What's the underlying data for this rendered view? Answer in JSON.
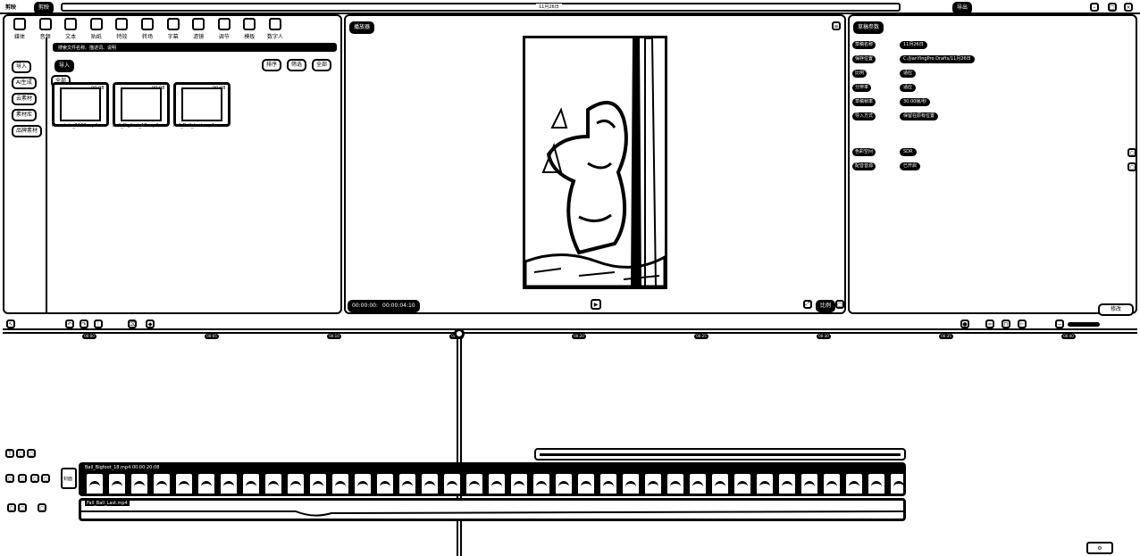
{
  "titlebar": {
    "app": "剪映",
    "tab": "剪映",
    "title": "11月26日",
    "right": [
      "导出"
    ]
  },
  "toolbar": {
    "items": [
      "媒体",
      "音频",
      "文本",
      "贴纸",
      "特效",
      "转场",
      "字幕",
      "滤镜",
      "调节",
      "模板",
      "数字人"
    ]
  },
  "sidebar": {
    "items": [
      "导入",
      "AI生成",
      "云素材",
      "素材库",
      "品牌素材"
    ]
  },
  "media": {
    "search_placeholder": "搜索文件名称、描述词、说明",
    "filter": "全部",
    "tag": "导入",
    "sort_buttons": [
      "排序",
      "筛选",
      "全部"
    ],
    "files": [
      {
        "name": "Mountain_1102.mp4",
        "duration": "00:08"
      },
      {
        "name": "Ball_Bigfoot_18.mp4",
        "duration": "00:08"
      },
      {
        "name": "Fall_Ball_Last.mp4",
        "duration": "00:08"
      }
    ]
  },
  "player": {
    "title": "播放器",
    "time_current": "00:00:00:00",
    "time_total": "00:00:04:10",
    "ratio": "比例"
  },
  "details": {
    "title": "草稿参数",
    "rows": [
      {
        "label": "草稿名称",
        "value": "11月26日"
      },
      {
        "label": "保存位置",
        "value": "C:/JianYingPro Drafts/11月26日"
      },
      {
        "label": "比例",
        "value": "适应"
      },
      {
        "label": "分辨率",
        "value": "适应"
      },
      {
        "label": "草稿帧率",
        "value": "30.00帧/秒"
      },
      {
        "label": "导入方式",
        "value": "保留在原有位置"
      },
      {
        "label": "色彩空间",
        "value": "SDR"
      },
      {
        "label": "配音音源",
        "value": "已开启"
      }
    ],
    "modify": "修改"
  },
  "timeline": {
    "ruler": [
      "00:00",
      "00:05",
      "00:10",
      "00:15",
      "00:20",
      "00:25",
      "00:30",
      "00:35",
      "00:40"
    ],
    "video_clip": "Ball_Bigfoot_18.mp4  00:00:20:08",
    "audio_clip": "Fall_Ball_Last.mp4",
    "cover": "封面"
  }
}
